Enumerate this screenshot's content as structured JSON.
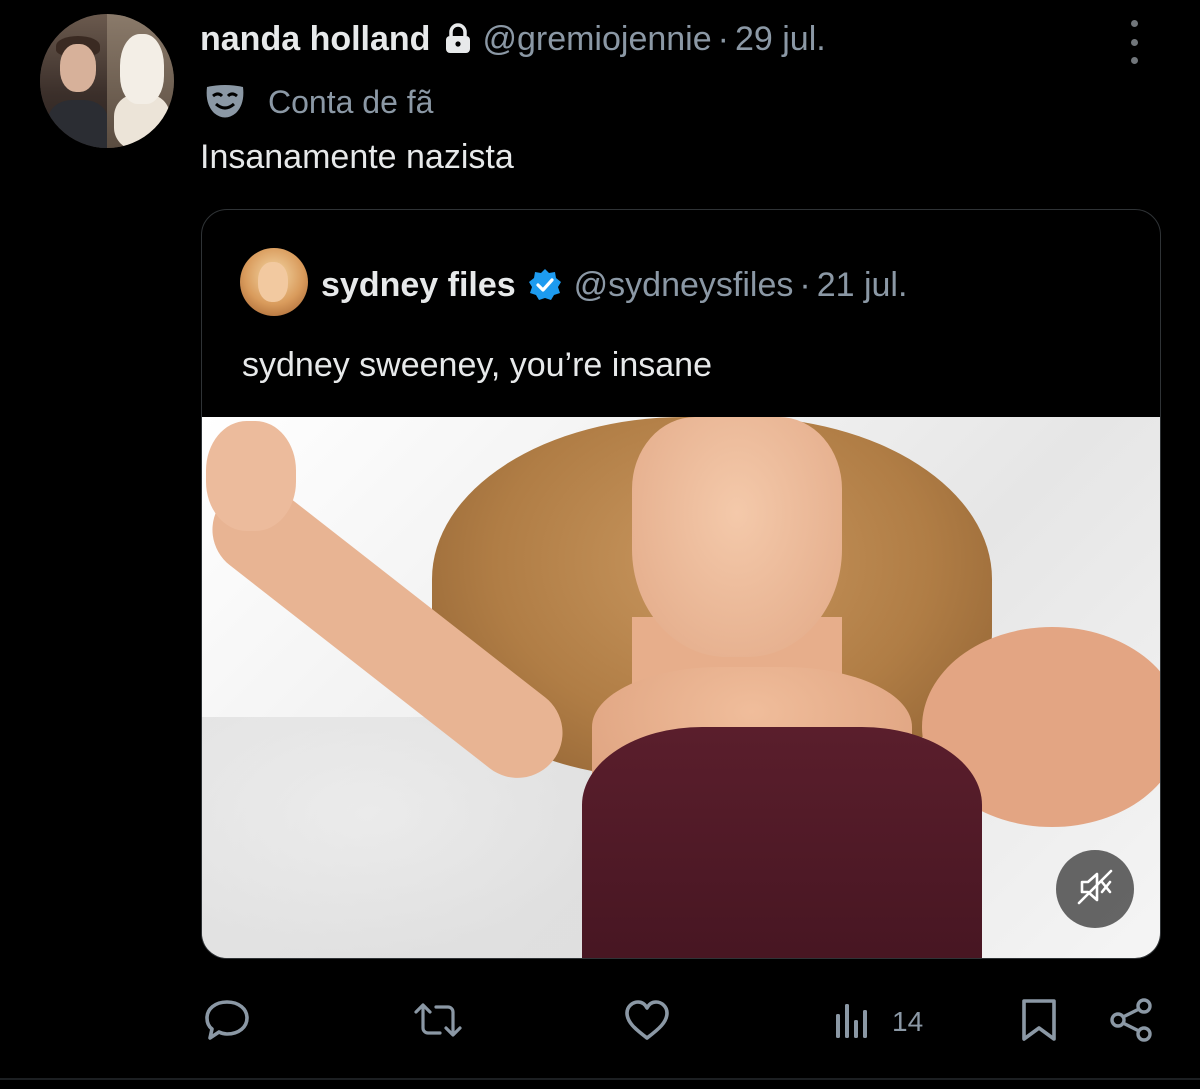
{
  "post": {
    "author": {
      "display_name": "nanda holland",
      "handle": "@gremiojennie",
      "date": "29 jul.",
      "separator": "·",
      "icons": {
        "lock": "lock-icon"
      }
    },
    "badge": {
      "icon": "mask-icon",
      "label": "Conta de fã"
    },
    "text": "Insanamente nazista",
    "menu_icon": "more-icon"
  },
  "quote": {
    "author": {
      "display_name": "sydney files",
      "handle": "@sydneysfiles",
      "date": "21 jul.",
      "separator": "·",
      "verified_icon": "verified-badge-icon"
    },
    "text": "sydney sweeney, you’re insane",
    "media": {
      "type": "video",
      "muted": true,
      "mute_icon": "muted-speaker-icon"
    }
  },
  "actions": {
    "reply_icon": "reply-icon",
    "repost_icon": "repost-icon",
    "like_icon": "heart-icon",
    "views_icon": "views-chart-icon",
    "views_count": "14",
    "bookmark_icon": "bookmark-icon",
    "share_icon": "share-icon"
  },
  "colors": {
    "background": "#000000",
    "primary_text": "#e7e9ea",
    "secondary_text": "#8b98a5",
    "verified_blue": "#1d9bf0",
    "border": "#2f3336"
  }
}
